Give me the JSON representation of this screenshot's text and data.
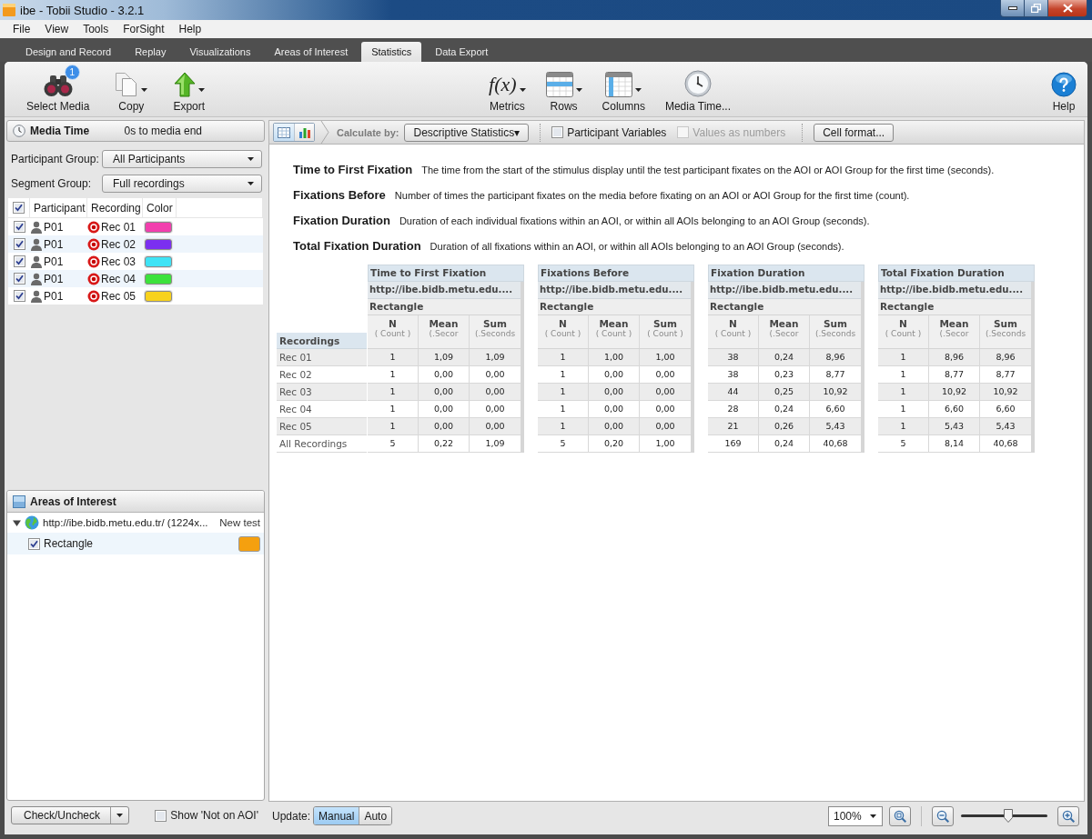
{
  "window": {
    "title": "ibe - Tobii Studio - 3.2.1"
  },
  "menu": [
    "File",
    "View",
    "Tools",
    "ForSight",
    "Help"
  ],
  "tabs": [
    {
      "label": "Design and Record",
      "selected": false
    },
    {
      "label": "Replay",
      "selected": false
    },
    {
      "label": "Visualizations",
      "selected": false
    },
    {
      "label": "Areas of Interest",
      "selected": false
    },
    {
      "label": "Statistics",
      "selected": true
    },
    {
      "label": "Data Export",
      "selected": false
    }
  ],
  "toolbar": {
    "left": [
      {
        "kind": "select_media",
        "label": "Select Media",
        "badge": "1",
        "dropdown": false
      },
      {
        "kind": "copy",
        "label": "Copy",
        "dropdown": true
      },
      {
        "kind": "export",
        "label": "Export",
        "dropdown": true
      }
    ],
    "center": [
      {
        "kind": "metrics",
        "label": "Metrics",
        "glyph": "f(x)",
        "dropdown": true
      },
      {
        "kind": "rows",
        "label": "Rows",
        "dropdown": true
      },
      {
        "kind": "columns",
        "label": "Columns",
        "dropdown": true
      },
      {
        "kind": "media_time",
        "label": "Media Time...",
        "dropdown": false
      }
    ],
    "right": [
      {
        "kind": "help",
        "label": "Help",
        "dropdown": false
      }
    ]
  },
  "media_time": {
    "title": "Media Time",
    "range": "0s to media end"
  },
  "filters": [
    {
      "label": "Participant Group:",
      "value": "All Participants"
    },
    {
      "label": "Segment Group:",
      "value": "Full recordings"
    }
  ],
  "recordings_list": {
    "all_checked": true,
    "columns": [
      "Participant",
      "Recording",
      "Color"
    ],
    "rows": [
      {
        "checked": true,
        "participant": "P01",
        "recording": "Rec 01",
        "color": "#f23fae"
      },
      {
        "checked": true,
        "participant": "P01",
        "recording": "Rec 02",
        "color": "#7b2ff0"
      },
      {
        "checked": true,
        "participant": "P01",
        "recording": "Rec 03",
        "color": "#3fe3f5"
      },
      {
        "checked": true,
        "participant": "P01",
        "recording": "Rec 04",
        "color": "#3ce23c"
      },
      {
        "checked": true,
        "participant": "P01",
        "recording": "Rec 05",
        "color": "#f8d21c"
      }
    ]
  },
  "aoi_panel": {
    "title": "Areas of Interest",
    "tree": [
      {
        "label": "http://ibe.bidb.metu.edu.tr/ (1224x...",
        "tag": "New test",
        "expanded": true,
        "children": [
          {
            "label": "Rectangle",
            "checked": true,
            "color": "#f5a00f"
          }
        ]
      }
    ]
  },
  "left_footer": {
    "button": "Check/Uncheck",
    "option": {
      "label": "Show 'Not on AOI'",
      "checked": false
    }
  },
  "stats_toolbar": {
    "views": [
      {
        "kind": "table",
        "selected": true
      },
      {
        "kind": "chart",
        "selected": false
      }
    ],
    "calculate_label": "Calculate by:",
    "calculate_value": "Descriptive Statistics▾",
    "options": [
      {
        "label": "Participant Variables",
        "checked": false,
        "disabled": false
      },
      {
        "label": "Values as numbers",
        "checked": false,
        "disabled": true
      }
    ],
    "cell_format": "Cell format..."
  },
  "definitions": [
    {
      "term": "Time to First Fixation",
      "text": "The time from the start of the stimulus display until the test participant fixates on the AOI or AOI Group for the first time (seconds)."
    },
    {
      "term": "Fixations Before",
      "text": "Number of times the participant fixates on the media before fixating on an AOI or AOI Group for the first time (count)."
    },
    {
      "term": "Fixation Duration",
      "text": "Duration of each individual fixations within an AOI, or within all AOIs belonging to an AOI Group (seconds)."
    },
    {
      "term": "Total Fixation Duration",
      "text": "Duration of all fixations within an AOI, or within all AOIs belonging to an AOI Group (seconds)."
    }
  ],
  "stats_table": {
    "row_header": "Recordings",
    "rows": [
      "Rec 01",
      "Rec 02",
      "Rec 03",
      "Rec 04",
      "Rec 05",
      "All Recordings"
    ],
    "groups": [
      {
        "title": "Time to First Fixation",
        "media": "http://ibe.bidb.metu.edu....",
        "aoi": "Rectangle",
        "columns": [
          {
            "name": "N",
            "unit": "( Count )"
          },
          {
            "name": "Mean",
            "unit": "(.Secor"
          },
          {
            "name": "Sum",
            "unit": "(.Seconds"
          }
        ],
        "rows": [
          [
            "1",
            "1,09",
            "1,09"
          ],
          [
            "1",
            "0,00",
            "0,00"
          ],
          [
            "1",
            "0,00",
            "0,00"
          ],
          [
            "1",
            "0,00",
            "0,00"
          ],
          [
            "1",
            "0,00",
            "0,00"
          ],
          [
            "5",
            "0,22",
            "1,09"
          ]
        ]
      },
      {
        "title": "Fixations Before",
        "media": "http://ibe.bidb.metu.edu....",
        "aoi": "Rectangle",
        "columns": [
          {
            "name": "N",
            "unit": "( Count )"
          },
          {
            "name": "Mean",
            "unit": "( Count )"
          },
          {
            "name": "Sum",
            "unit": "( Count )"
          }
        ],
        "rows": [
          [
            "1",
            "1,00",
            "1,00"
          ],
          [
            "1",
            "0,00",
            "0,00"
          ],
          [
            "1",
            "0,00",
            "0,00"
          ],
          [
            "1",
            "0,00",
            "0,00"
          ],
          [
            "1",
            "0,00",
            "0,00"
          ],
          [
            "5",
            "0,20",
            "1,00"
          ]
        ]
      },
      {
        "title": "Fixation Duration",
        "media": "http://ibe.bidb.metu.edu....",
        "aoi": "Rectangle",
        "columns": [
          {
            "name": "N",
            "unit": "( Count )"
          },
          {
            "name": "Mean",
            "unit": "(.Secor"
          },
          {
            "name": "Sum",
            "unit": "(.Seconds"
          }
        ],
        "rows": [
          [
            "38",
            "0,24",
            "8,96"
          ],
          [
            "38",
            "0,23",
            "8,77"
          ],
          [
            "44",
            "0,25",
            "10,92"
          ],
          [
            "28",
            "0,24",
            "6,60"
          ],
          [
            "21",
            "0,26",
            "5,43"
          ],
          [
            "169",
            "0,24",
            "40,68"
          ]
        ]
      },
      {
        "title": "Total Fixation Duration",
        "media": "http://ibe.bidb.metu.edu....",
        "aoi": "Rectangle",
        "columns": [
          {
            "name": "N",
            "unit": "( Count )"
          },
          {
            "name": "Mean",
            "unit": "(.Secor"
          },
          {
            "name": "Sum",
            "unit": "(.Seconds"
          }
        ],
        "rows": [
          [
            "1",
            "8,96",
            "8,96"
          ],
          [
            "1",
            "8,77",
            "8,77"
          ],
          [
            "1",
            "10,92",
            "10,92"
          ],
          [
            "1",
            "6,60",
            "6,60"
          ],
          [
            "1",
            "5,43",
            "5,43"
          ],
          [
            "5",
            "8,14",
            "40,68"
          ]
        ]
      }
    ]
  },
  "stats_footer": {
    "update_label": "Update:",
    "modes": [
      {
        "label": "Manual",
        "selected": true
      },
      {
        "label": "Auto",
        "selected": false
      }
    ],
    "zoom": "100%",
    "zoom_slider": {
      "level": 0.55
    }
  }
}
